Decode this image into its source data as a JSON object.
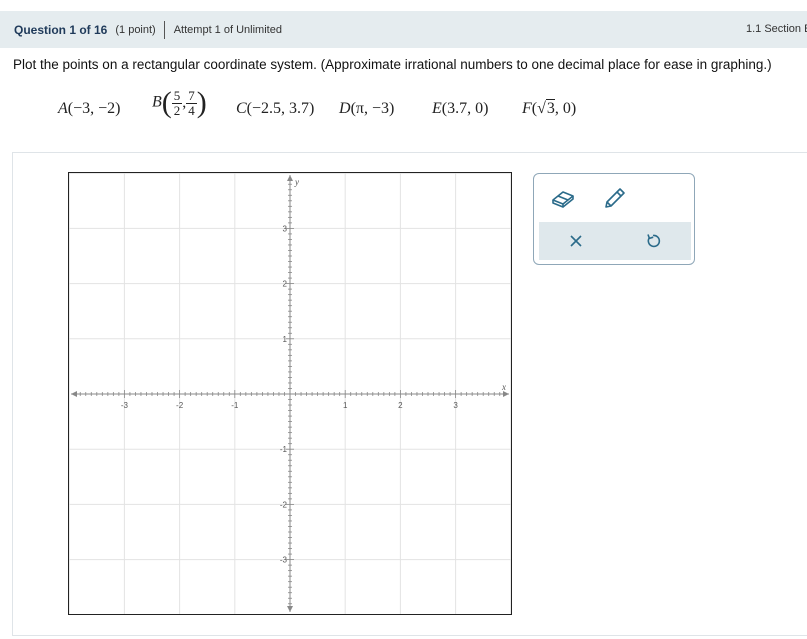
{
  "header": {
    "question_label": "Question 1 of 16",
    "points_label": "(1 point)",
    "attempt_label": "Attempt 1 of Unlimited",
    "section_label": "1.1 Section E"
  },
  "instruction": "Plot the points on a rectangular coordinate system. (Approximate irrational numbers to one decimal place for ease in graphing.)",
  "points": {
    "a": {
      "name": "A",
      "coords": "(−3, −2)"
    },
    "b": {
      "name": "B",
      "x_num": "5",
      "x_den": "2",
      "y_num": "7",
      "y_den": "4"
    },
    "c": {
      "name": "C",
      "coords": "(−2.5, 3.7)"
    },
    "d": {
      "name": "D",
      "coords": "(π, −3)"
    },
    "e": {
      "name": "E",
      "coords": "(3.7, 0)"
    },
    "f": {
      "name": "F",
      "radicand": "3",
      "tail": ", 0)"
    }
  },
  "graph": {
    "x_axis_label": "x",
    "y_axis_label": "y",
    "x_ticks": [
      -3,
      -2,
      -1,
      1,
      2,
      3
    ],
    "y_ticks": [
      -3,
      -2,
      -1,
      1,
      2,
      3
    ],
    "xlim": [
      -4,
      4
    ],
    "ylim": [
      -4,
      4
    ],
    "minor_step": 0.1,
    "grid_color": "#e3e3e3",
    "axis_color": "#888888"
  },
  "toolbox": {
    "eraser_icon": "eraser-icon",
    "pencil_icon": "pencil-icon",
    "clear_icon": "close-icon",
    "undo_icon": "undo-icon",
    "icon_color": "#2b6b8a"
  }
}
